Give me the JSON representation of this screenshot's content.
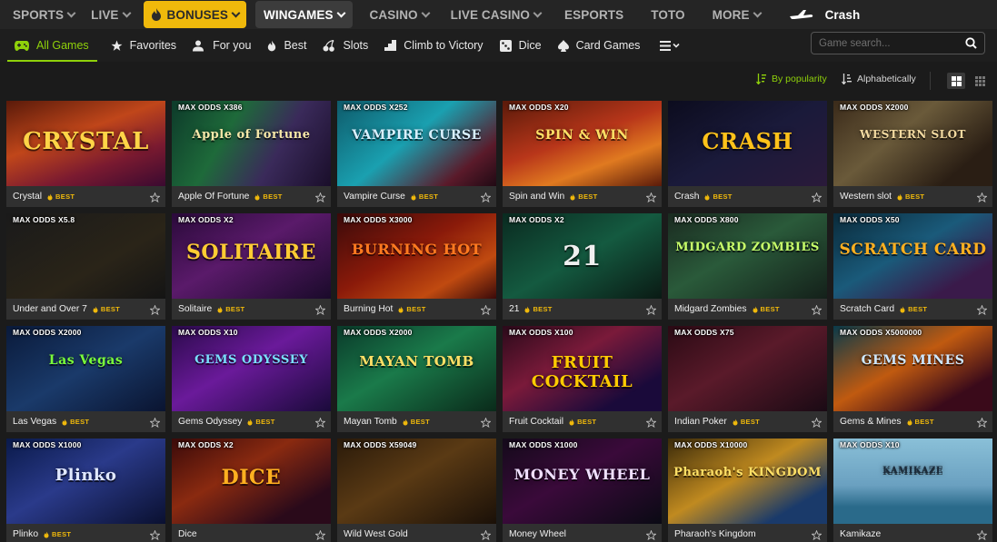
{
  "top_nav": {
    "items": [
      {
        "label": "SPORTS"
      },
      {
        "label": "LIVE"
      },
      {
        "label": "BONUSES"
      },
      {
        "label": "WINGAMES"
      },
      {
        "label": "CASINO"
      },
      {
        "label": "LIVE CASINO"
      },
      {
        "label": "ESPORTS"
      },
      {
        "label": "TOTO"
      },
      {
        "label": "MORE"
      },
      {
        "label": "Crash"
      }
    ]
  },
  "sub_nav": {
    "items": [
      {
        "label": "All Games"
      },
      {
        "label": "Favorites"
      },
      {
        "label": "For you"
      },
      {
        "label": "Best"
      },
      {
        "label": "Slots"
      },
      {
        "label": "Climb to Victory"
      },
      {
        "label": "Dice"
      },
      {
        "label": "Card Games"
      }
    ],
    "search_placeholder": "Game search..."
  },
  "sort": {
    "popularity": "By popularity",
    "alphabetical": "Alphabetically"
  },
  "colors": {
    "accent_green": "#8fd10a",
    "bonus_yellow": "#f0b90b",
    "best_badge": "#f0b90b"
  },
  "best_label": "BEST",
  "games": [
    {
      "name": "Crystal",
      "odds": "",
      "best": true,
      "art_text": "CRYSTAL"
    },
    {
      "name": "Apple Of Fortune",
      "odds": "MAX ODDS X386",
      "best": true,
      "art_text": "Apple of Fortune"
    },
    {
      "name": "Vampire Curse",
      "odds": "MAX ODDS X252",
      "best": true,
      "art_text": "VAMPIRE CURSE"
    },
    {
      "name": "Spin and Win",
      "odds": "MAX ODDS X20",
      "best": true,
      "art_text": "SPIN & WIN"
    },
    {
      "name": "Crash",
      "odds": "",
      "best": true,
      "art_text": "CRASH"
    },
    {
      "name": "Western slot",
      "odds": "MAX ODDS X2000",
      "best": true,
      "art_text": "WESTERN SLOT"
    },
    {
      "name": "Under and Over 7",
      "odds": "MAX ODDS X5.8",
      "best": true,
      "art_text": ""
    },
    {
      "name": "Solitaire",
      "odds": "MAX ODDS X2",
      "best": true,
      "art_text": "SOLITAIRE"
    },
    {
      "name": "Burning Hot",
      "odds": "MAX ODDS X3000",
      "best": true,
      "art_text": "BURNING HOT"
    },
    {
      "name": "21",
      "odds": "MAX ODDS X2",
      "best": true,
      "art_text": "21"
    },
    {
      "name": "Midgard Zombies",
      "odds": "MAX ODDS X800",
      "best": true,
      "art_text": "MIDGARD ZOMBIES"
    },
    {
      "name": "Scratch Card",
      "odds": "MAX ODDS X50",
      "best": true,
      "art_text": "SCRATCH CARD"
    },
    {
      "name": "Las Vegas",
      "odds": "MAX ODDS X2000",
      "best": true,
      "art_text": "Las Vegas"
    },
    {
      "name": "Gems Odyssey",
      "odds": "MAX ODDS X10",
      "best": true,
      "art_text": "GEMS ODYSSEY"
    },
    {
      "name": "Mayan Tomb",
      "odds": "MAX ODDS X2000",
      "best": true,
      "art_text": "MAYAN TOMB"
    },
    {
      "name": "Fruit Cocktail",
      "odds": "MAX ODDS X100",
      "best": true,
      "art_text": "FRUIT COCKTAIL"
    },
    {
      "name": "Indian Poker",
      "odds": "MAX ODDS X75",
      "best": true,
      "art_text": ""
    },
    {
      "name": "Gems & Mines",
      "odds": "MAX ODDS X5000000",
      "best": true,
      "art_text": "GEMS MINES"
    },
    {
      "name": "Plinko",
      "odds": "MAX ODDS X1000",
      "best": true,
      "art_text": "Plinko"
    },
    {
      "name": "Dice",
      "odds": "MAX ODDS X2",
      "best": false,
      "art_text": "DICE"
    },
    {
      "name": "Wild West Gold",
      "odds": "MAX ODDS X59049",
      "best": false,
      "art_text": ""
    },
    {
      "name": "Money Wheel",
      "odds": "MAX ODDS X1000",
      "best": false,
      "art_text": "MONEY WHEEL"
    },
    {
      "name": "Pharaoh's Kingdom",
      "odds": "MAX ODDS X10000",
      "best": false,
      "art_text": "Pharaoh's KINGDOM"
    },
    {
      "name": "Kamikaze",
      "odds": "MAX ODDS X10",
      "best": false,
      "art_text": "KAMIKAZE"
    }
  ]
}
